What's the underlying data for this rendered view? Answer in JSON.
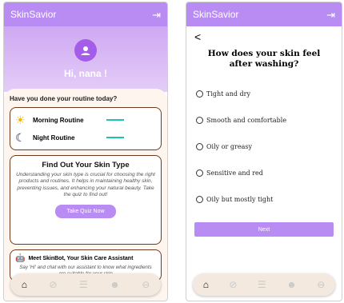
{
  "left": {
    "app_title": "SkinSavior",
    "logout_icon": "logout-icon",
    "greeting": "Hi, nana !",
    "question": "Have you done your routine today?",
    "routines": [
      {
        "label": "Morning Routine",
        "icon": "sun-icon"
      },
      {
        "label": "Night Routine",
        "icon": "moon-icon"
      }
    ],
    "quiz": {
      "title": "Find Out Your Skin Type",
      "description": "Understanding your skin type is crucial for choosing the right products and routines. It helps in maintaining healthy skin, preventing issues, and enhancing your natural beauty. Take the quiz to find out!",
      "button": "Take Quiz Now"
    },
    "bot": {
      "title": "Meet SkinBot, Your Skin Care Assistant",
      "description": "Say 'Hi' and chat with our assistant to know what ingredients are suitable for your skin"
    }
  },
  "right": {
    "app_title": "SkinSavior",
    "back": "<",
    "question": "How does your skin feel after washing?",
    "options": [
      "Tight and dry",
      "Smooth and comfortable",
      "Oily or greasy",
      "Sensitive and red",
      "Oily but mostly tight"
    ],
    "next": "Next"
  },
  "nav_icons": [
    "home-icon",
    "check-circle-icon",
    "checklist-icon",
    "robot-icon",
    "profile-icon"
  ],
  "colors": {
    "accent": "#b98cf3",
    "routine_bar": "#1cc2b4",
    "card_border": "#6f3a1e"
  }
}
